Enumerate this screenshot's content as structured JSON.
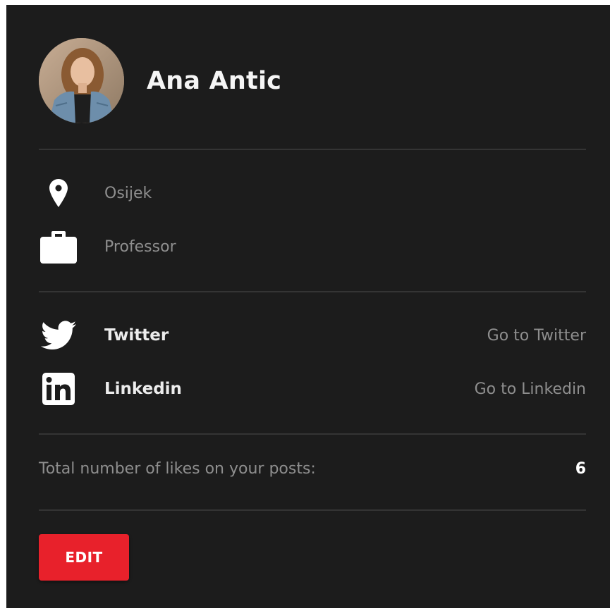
{
  "profile": {
    "name": "Ana Antic",
    "avatar_alt": "profile-photo"
  },
  "info": {
    "location": "Osijek",
    "location_icon": "map-pin-icon",
    "occupation": "Professor",
    "occupation_icon": "briefcase-icon"
  },
  "social": [
    {
      "icon": "twitter-icon",
      "label": "Twitter",
      "link_text": "Go to Twitter"
    },
    {
      "icon": "linkedin-icon",
      "label": "Linkedin",
      "link_text": "Go to Linkedin"
    }
  ],
  "stats": {
    "likes_label": "Total number of likes on your posts:",
    "likes_value": "6"
  },
  "actions": {
    "edit_label": "EDIT"
  },
  "colors": {
    "card_background": "#1c1c1c",
    "accent_red": "#e8212b",
    "muted_text": "#8e8e8e",
    "divider": "#343434"
  }
}
